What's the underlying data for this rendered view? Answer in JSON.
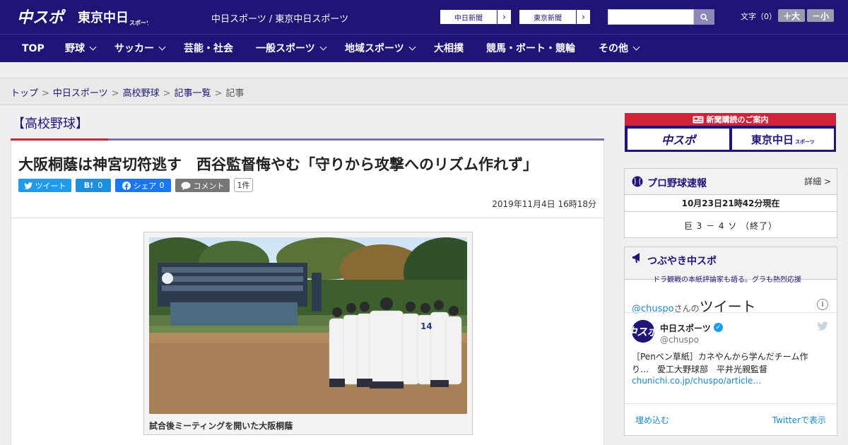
{
  "header": {
    "logo_chuspo": "中スポ",
    "logo_tokyo": "東京中日",
    "logo_tokyo_sub": "スポーツ",
    "site_title": "中日スポーツ / 東京中日スポーツ",
    "ext_links": [
      {
        "label": "中日新聞"
      },
      {
        "label": "東京新聞"
      }
    ],
    "search": {
      "placeholder": ""
    },
    "font_size_label": "文字（0）",
    "font_plus": "＋大",
    "font_minus": "－小"
  },
  "nav": {
    "items": [
      {
        "label": "TOP"
      },
      {
        "label": "野球"
      },
      {
        "label": "サッカー"
      },
      {
        "label": "芸能・社会"
      },
      {
        "label": "一般スポーツ"
      },
      {
        "label": "地域スポーツ"
      },
      {
        "label": "大相撲"
      },
      {
        "label": "競馬・ボート・競輪"
      },
      {
        "label": "その他"
      }
    ]
  },
  "breadcrumb": {
    "items": [
      "トップ",
      "中日スポーツ",
      "高校野球",
      "記事一覧"
    ],
    "current": "記事",
    "sep": ">"
  },
  "article": {
    "category": "【高校野球】",
    "headline": "大阪桐蔭は神宮切符逃す　西谷監督悔やむ「守りから攻撃へのリズム作れず」",
    "share": {
      "tweet": "ツイート",
      "hatena": "B!",
      "hatena_count": "0",
      "fb": "シェア",
      "fb_count": "0",
      "comment": "コメント",
      "comment_count": "1件"
    },
    "date": "2019年11月4日 16時18分",
    "photo_caption": "試合後ミーティングを開いた大阪桐蔭"
  },
  "sidebar": {
    "subscribe": {
      "label": "新聞購読のご案内",
      "logo1": "中スポ",
      "logo2": "東京中日",
      "logo2_sub": "スポーツ"
    },
    "baseball": {
      "title": "プロ野球速報",
      "detail": "詳細 >",
      "as_of": "10月23日21時42分現在",
      "score": "巨 3 － 4 ソ （終了）"
    },
    "twitter": {
      "title": "つぶやき中スポ",
      "subtitle": "ドラ観戦の本紙評論家も語る。グラも熱烈応援",
      "by_handle": "@chuspo",
      "by_suffix": "さんの",
      "by_big": "ツイート",
      "name": "中日スポーツ",
      "handle": "@chuspo",
      "text": "［Penペン草紙］カネやんから学んだチーム作り…　愛工大野球部　平井光親監督",
      "link": "chunichi.co.jp/chuspo/article…",
      "embed": "埋め込む",
      "view": "Twitterで表示"
    }
  },
  "colors": {
    "brand": "#1e1577",
    "accent_red": "#d0233a",
    "link": "#1a87c7"
  }
}
